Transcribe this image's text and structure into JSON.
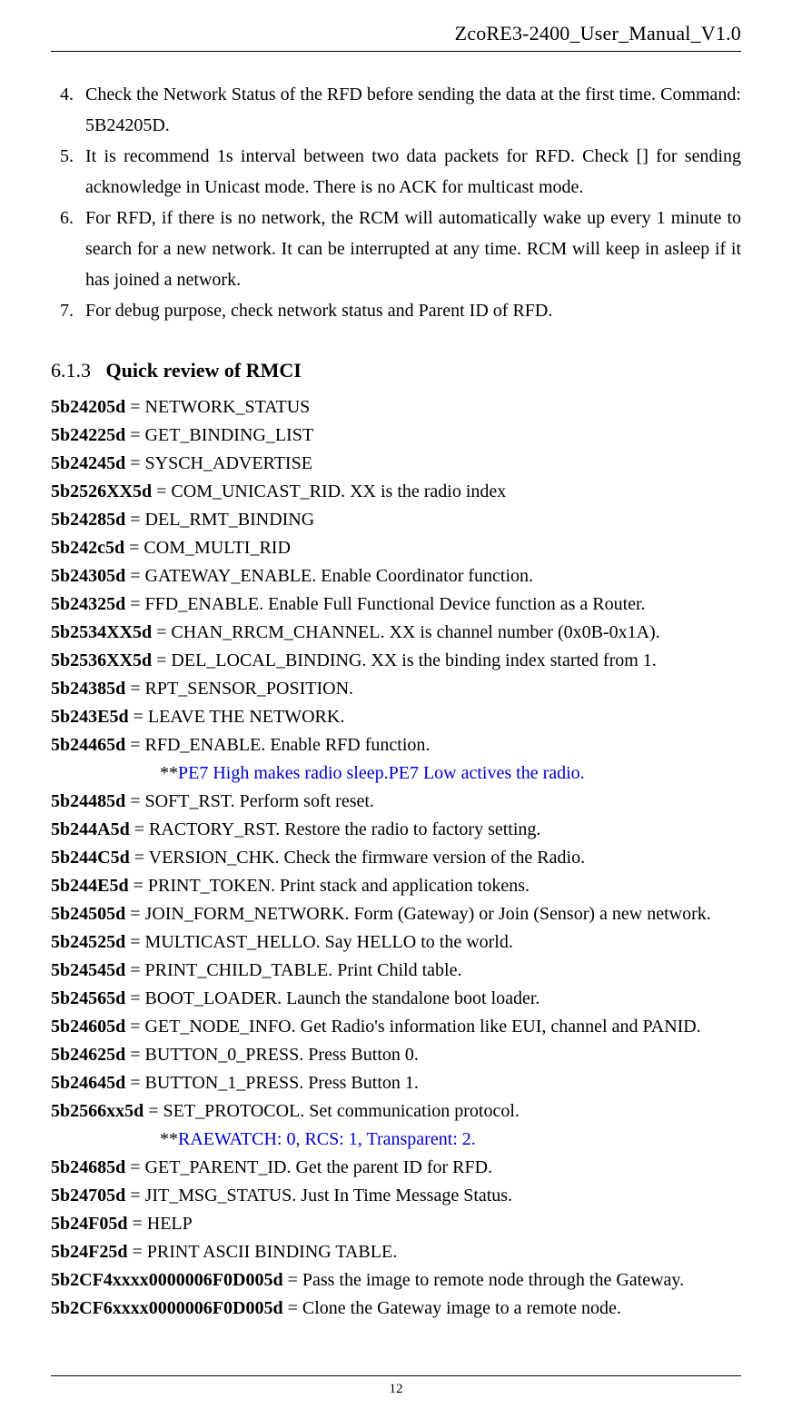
{
  "header": {
    "title": "ZcoRE3-2400_User_Manual_V1.0"
  },
  "numbered_list": {
    "start": 4,
    "items": [
      "Check the Network Status of the RFD before sending the data at the first time. Command: 5B24205D.",
      "It is recommend 1s interval between two data packets for RFD. Check [] for sending acknowledge in Unicast mode. There is no ACK for multicast mode.",
      "For RFD, if there is no network, the RCM will automatically wake up every 1 minute to search for a new network. It can be interrupted at any time. RCM will keep in asleep if it has joined a network.",
      "For debug purpose, check network status and Parent ID of RFD."
    ]
  },
  "section": {
    "number": "6.1.3",
    "title": "Quick review of RMCI"
  },
  "commands": [
    {
      "code": "5b24205d",
      "desc": " = NETWORK_STATUS"
    },
    {
      "code": "5b24225d",
      "desc": " = GET_BINDING_LIST"
    },
    {
      "code": "5b24245d",
      "desc": " = SYSCH_ADVERTISE"
    },
    {
      "code": "5b2526XX5d",
      "desc": " = COM_UNICAST_RID. XX is the radio index"
    },
    {
      "code": "5b24285d",
      "desc": " = DEL_RMT_BINDING"
    },
    {
      "code": "5b242c5d",
      "desc": " = COM_MULTI_RID"
    },
    {
      "code": "5b24305d",
      "desc": " = GATEWAY_ENABLE. Enable Coordinator function."
    },
    {
      "code": "5b24325d",
      "desc": " = FFD_ENABLE. Enable Full Functional Device function as a Router."
    },
    {
      "code": "5b2534XX5d",
      "desc": " = CHAN_RRCM_CHANNEL. XX is channel number (0x0B-0x1A)."
    },
    {
      "code": "5b2536XX5d",
      "desc": " = DEL_LOCAL_BINDING. XX is the binding index started from 1."
    },
    {
      "code": "5b24385d",
      "desc": " = RPT_SENSOR_POSITION."
    },
    {
      "code": "5b243E5d",
      "desc": " = LEAVE THE NETWORK."
    },
    {
      "code": "5b24465d",
      "desc": " = RFD_ENABLE. Enable RFD function."
    }
  ],
  "note1": {
    "stars": "**",
    "text": "PE7 High makes radio sleep.PE7 Low actives the radio."
  },
  "commands2": [
    {
      "code": "5b24485d",
      "desc": " = SOFT_RST. Perform soft reset."
    },
    {
      "code": "5b244A5d",
      "desc": " = RACTORY_RST. Restore the radio to factory setting."
    },
    {
      "code": "5b244C5d",
      "desc": " = VERSION_CHK. Check the firmware version of the Radio."
    },
    {
      "code": "5b244E5d",
      "desc": " = PRINT_TOKEN. Print stack and application tokens."
    },
    {
      "code": "5b24505d",
      "desc": " = JOIN_FORM_NETWORK. Form (Gateway) or Join (Sensor) a new network."
    },
    {
      "code": "5b24525d",
      "desc": " = MULTICAST_HELLO. Say HELLO to the world."
    },
    {
      "code": "5b24545d",
      "desc": " = PRINT_CHILD_TABLE. Print Child table."
    },
    {
      "code": "5b24565d",
      "desc": " = BOOT_LOADER. Launch the standalone boot loader."
    },
    {
      "code": "5b24605d",
      "desc": " = GET_NODE_INFO. Get Radio's information like EUI, channel and PANID."
    },
    {
      "code": "5b24625d",
      "desc": " = BUTTON_0_PRESS. Press Button 0."
    },
    {
      "code": "5b24645d",
      "desc": " = BUTTON_1_PRESS. Press Button 1."
    },
    {
      "code": "5b2566xx5d",
      "desc": " = SET_PROTOCOL. Set communication protocol."
    }
  ],
  "note2": {
    "stars": "**",
    "text": "RAEWATCH: 0, RCS: 1, Transparent: 2."
  },
  "commands3": [
    {
      "code": "5b24685d",
      "desc": " = GET_PARENT_ID. Get the parent ID for RFD."
    },
    {
      "code": "5b24705d",
      "desc": " = JIT_MSG_STATUS. Just In Time Message Status."
    },
    {
      "code": "5b24F05d",
      "desc": " = HELP"
    },
    {
      "code": "5b24F25d",
      "desc": " = PRINT ASCII BINDING TABLE."
    },
    {
      "code": "5b2CF4xxxx0000006F0D005d",
      "desc": " = Pass the image to remote node through the Gateway."
    },
    {
      "code": "5b2CF6xxxx0000006F0D005d",
      "desc": " = Clone the Gateway image to a remote node."
    }
  ],
  "footer": {
    "page": "12"
  }
}
